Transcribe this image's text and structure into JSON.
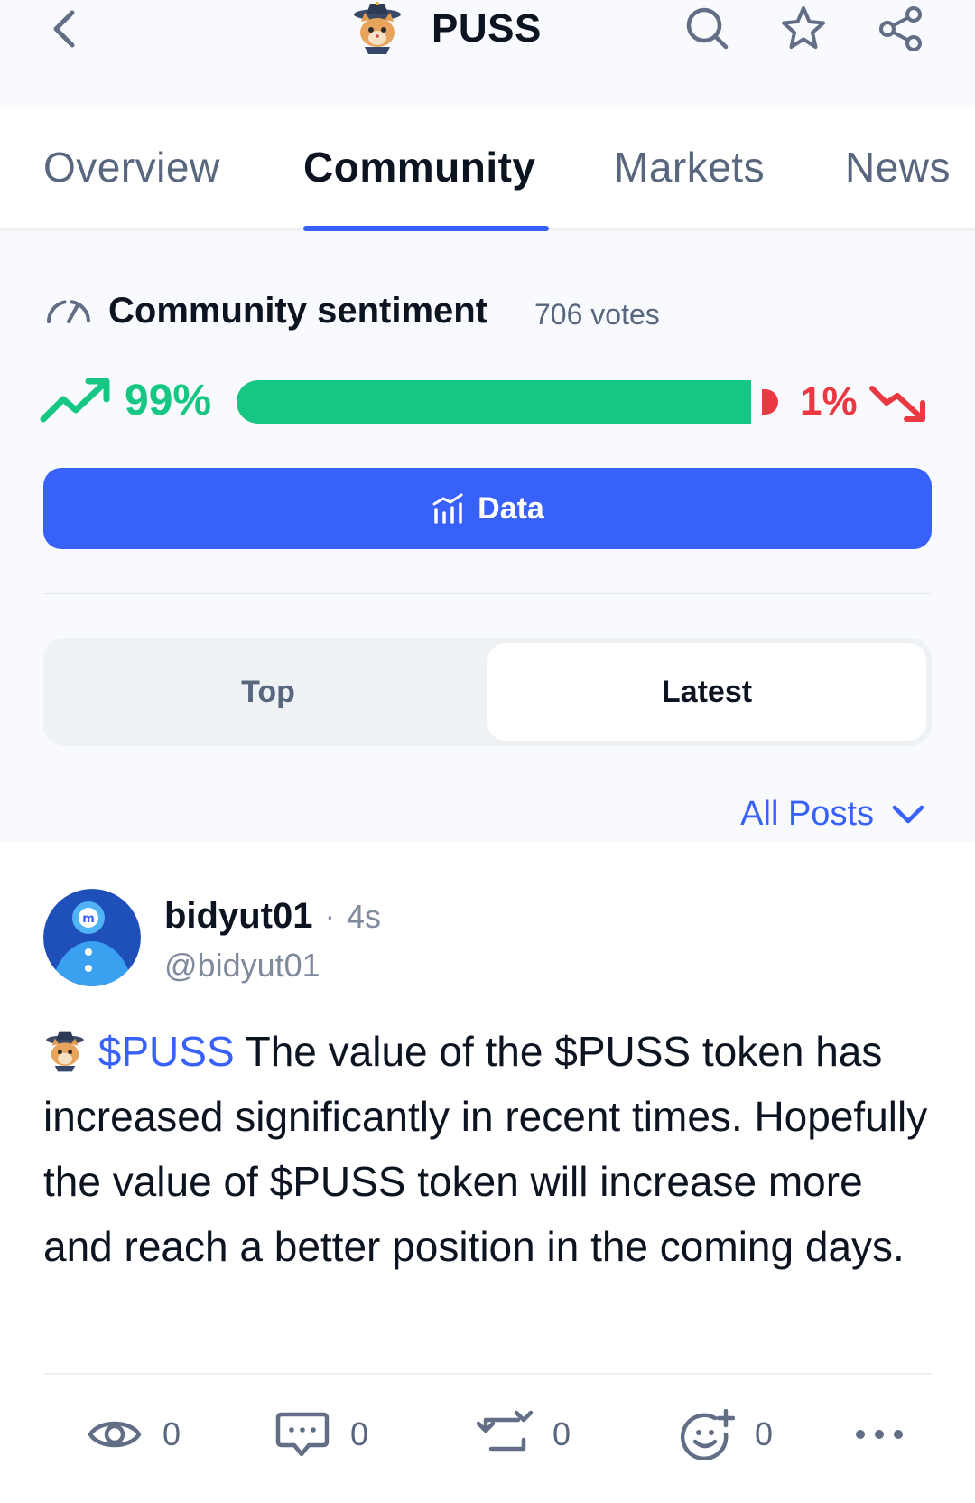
{
  "header": {
    "title": "PUSS",
    "icons": [
      "back-icon",
      "puss-logo",
      "search-icon",
      "star-icon",
      "share-icon"
    ]
  },
  "tabs": [
    {
      "label": "Overview",
      "active": false
    },
    {
      "label": "Community",
      "active": true
    },
    {
      "label": "Markets",
      "active": false
    },
    {
      "label": "News",
      "active": false
    }
  ],
  "sentiment": {
    "title": "Community sentiment",
    "votes": "706 votes",
    "bullish_pct": "99%",
    "bearish_pct": "1%",
    "bullish_fraction": 0.99,
    "bearish_fraction": 0.01
  },
  "data_button": {
    "label": "Data"
  },
  "feed_toggle": {
    "top": "Top",
    "latest": "Latest",
    "selected": "Latest"
  },
  "filter": {
    "label": "All Posts"
  },
  "post": {
    "username": "bidyut01",
    "separator": "·",
    "time": "4s",
    "handle": "@bidyut01",
    "cashtag": "$PUSS",
    "text": " The value of the $PUSS token has increased significantly in recent times. Hopefully the value of $PUSS token will increase more and reach a better position in the coming days.",
    "actions": {
      "views": "0",
      "comments": "0",
      "reposts": "0",
      "reactions": "0"
    }
  },
  "colors": {
    "accent": "#3861fb",
    "bullish": "#16c784",
    "bearish": "#ea3943",
    "text_primary": "#0d1421",
    "text_secondary": "#58667e"
  }
}
